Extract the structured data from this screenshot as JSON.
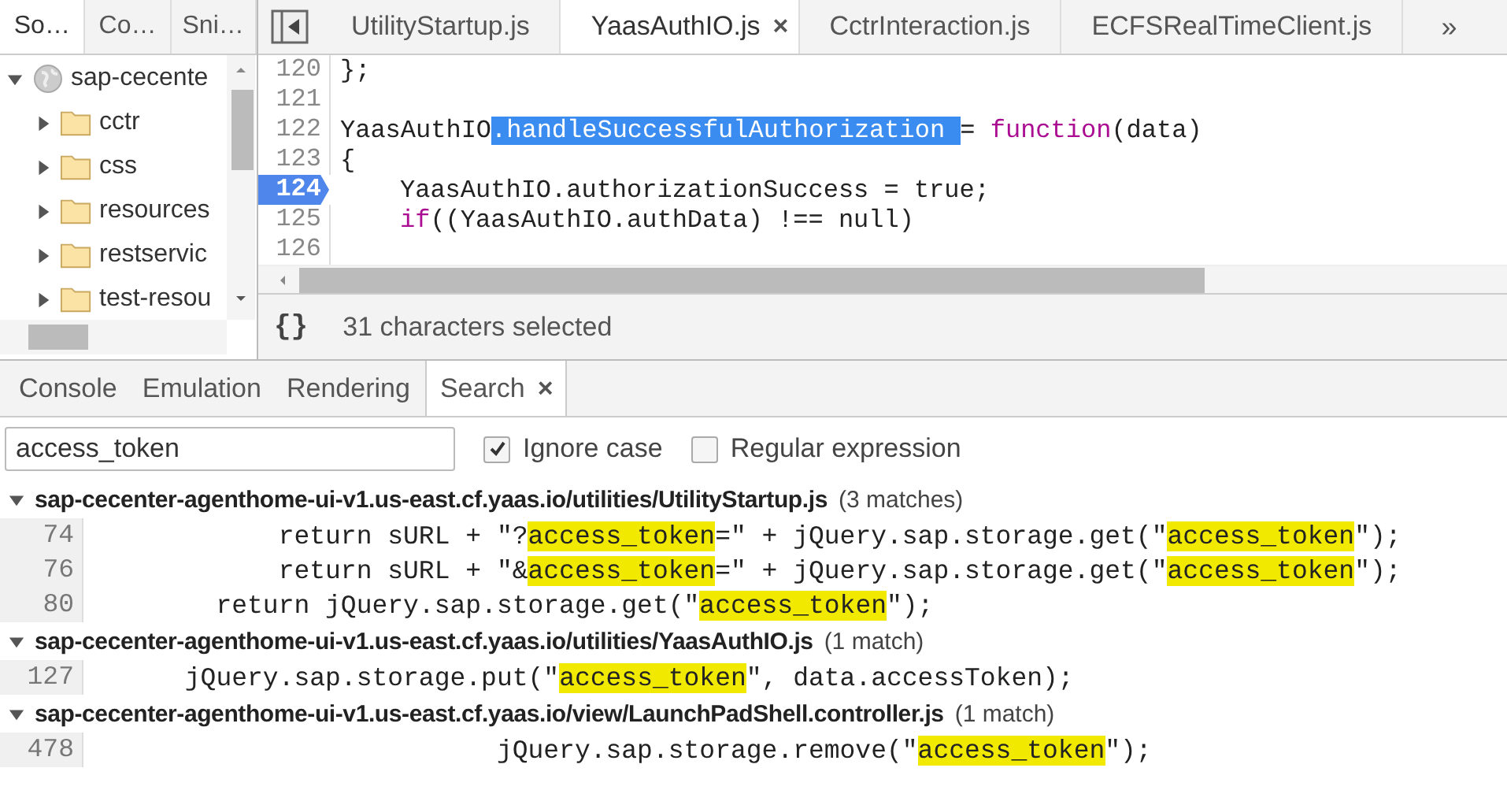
{
  "navigator": {
    "tabs": [
      {
        "label": "So…",
        "selected": true
      },
      {
        "label": "Co…",
        "selected": false
      },
      {
        "label": "Sni…",
        "selected": false
      }
    ],
    "tree": [
      {
        "label": "sap-cecente",
        "kind": "domain",
        "expanded": true,
        "children": [
          {
            "label": "cctr",
            "kind": "folder",
            "expanded": false
          },
          {
            "label": "css",
            "kind": "folder",
            "expanded": false
          },
          {
            "label": "resources",
            "kind": "folder",
            "expanded": false
          },
          {
            "label": "restservic",
            "kind": "folder",
            "expanded": false
          },
          {
            "label": "test-resou",
            "kind": "folder",
            "expanded": false
          }
        ]
      }
    ]
  },
  "editor": {
    "tabs": [
      {
        "label": "UtilityStartup.js",
        "selected": false
      },
      {
        "label": "YaasAuthIO.js",
        "selected": true,
        "close": "×"
      },
      {
        "label": "CctrInteraction.js",
        "selected": false
      },
      {
        "label": "ECFSRealTimeClient.js",
        "selected": false
      }
    ],
    "more": "»",
    "lines": [
      {
        "number": "120",
        "breakpoint": false,
        "indented": false,
        "segments": [
          {
            "text": "};",
            "kind": "plain"
          }
        ]
      },
      {
        "number": "121",
        "breakpoint": false
      },
      {
        "number": "122",
        "breakpoint": false,
        "indented": false,
        "segments": [
          {
            "text": "YaasAuthIO",
            "kind": "plain"
          },
          {
            "text": ".handleSuccessfulAuthorization ",
            "kind": "selected"
          },
          {
            "text": "= ",
            "kind": "plain"
          },
          {
            "text": "function",
            "kind": "keyword"
          },
          {
            "text": "(data)",
            "kind": "plain"
          }
        ]
      },
      {
        "number": "123",
        "breakpoint": false,
        "indented": false,
        "segments": [
          {
            "text": "{",
            "kind": "plain"
          }
        ]
      },
      {
        "number": "124",
        "breakpoint": true,
        "indented": true,
        "segments": [
          {
            "text": "YaasAuthIO.authorizationSuccess = true;",
            "kind": "plain"
          }
        ]
      },
      {
        "number": "125",
        "breakpoint": false,
        "indented": true,
        "segments": [
          {
            "text": "if",
            "kind": "keyword"
          },
          {
            "text": "((YaasAuthIO.authData) !== null)",
            "kind": "plain"
          }
        ]
      },
      {
        "number": "126",
        "breakpoint": false
      }
    ],
    "status": {
      "format": "{}",
      "message": "31 characters selected"
    }
  },
  "drawer": {
    "tabs": [
      {
        "label": "Console",
        "selected": false
      },
      {
        "label": "Emulation",
        "selected": false
      },
      {
        "label": "Rendering",
        "selected": false
      },
      {
        "label": "Search",
        "selected": true,
        "close": "×"
      }
    ],
    "search": {
      "value": "access_token",
      "options": [
        {
          "label": "Ignore case",
          "checked": true
        },
        {
          "label": "Regular expression",
          "checked": false
        }
      ]
    },
    "results": [
      {
        "file": "sap-cecenter-agenthome-ui-v1.us-east.cf.yaas.io/utilities/UtilityStartup.js",
        "count": "(3 matches)",
        "expanded": true,
        "lines": [
          {
            "number": "74",
            "segments": [
              {
                "text": "            return sURL + \"?",
                "kind": "plain"
              },
              {
                "text": "access_token",
                "kind": "match"
              },
              {
                "text": "=\" + jQuery.sap.storage.get(\"",
                "kind": "plain"
              },
              {
                "text": "access_token",
                "kind": "match"
              },
              {
                "text": "\");",
                "kind": "plain"
              }
            ]
          },
          {
            "number": "76",
            "segments": [
              {
                "text": "            return sURL + \"&",
                "kind": "plain"
              },
              {
                "text": "access_token",
                "kind": "match"
              },
              {
                "text": "=\" + jQuery.sap.storage.get(\"",
                "kind": "plain"
              },
              {
                "text": "access_token",
                "kind": "match"
              },
              {
                "text": "\");",
                "kind": "plain"
              }
            ]
          },
          {
            "number": "80",
            "segments": [
              {
                "text": "        return jQuery.sap.storage.get(\"",
                "kind": "plain"
              },
              {
                "text": "access_token",
                "kind": "match"
              },
              {
                "text": "\");",
                "kind": "plain"
              }
            ]
          }
        ]
      },
      {
        "file": "sap-cecenter-agenthome-ui-v1.us-east.cf.yaas.io/utilities/YaasAuthIO.js",
        "count": "(1 match)",
        "expanded": true,
        "lines": [
          {
            "number": "127",
            "segments": [
              {
                "text": "      jQuery.sap.storage.put(\"",
                "kind": "plain"
              },
              {
                "text": "access_token",
                "kind": "match"
              },
              {
                "text": "\", data.accessToken);",
                "kind": "plain"
              }
            ]
          }
        ]
      },
      {
        "file": "sap-cecenter-agenthome-ui-v1.us-east.cf.yaas.io/view/LaunchPadShell.controller.js",
        "count": "(1 match)",
        "expanded": true,
        "lines": [
          {
            "number": "478",
            "segments": [
              {
                "text": "                          jQuery.sap.storage.remove(\"",
                "kind": "plain"
              },
              {
                "text": "access_token",
                "kind": "match"
              },
              {
                "text": "\");",
                "kind": "plain"
              }
            ]
          }
        ]
      }
    ]
  }
}
